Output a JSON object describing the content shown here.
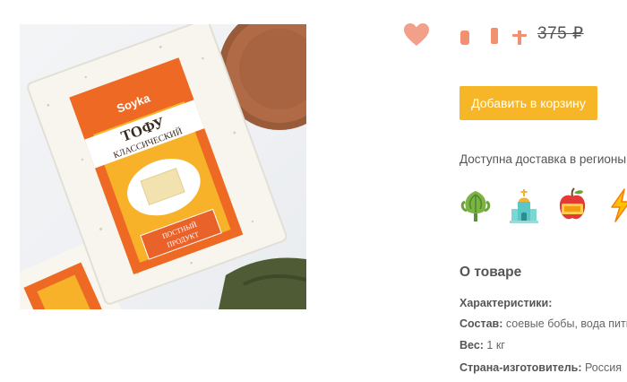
{
  "product": {
    "image_texts": {
      "brand": "Soyka",
      "name_line1": "ТОФУ",
      "name_line2": "КЛАССИЧЕСКИЙ",
      "badge_line1": "ПОСТНЫЙ",
      "badge_line2": "ПРОДУКТ"
    },
    "price_old": "375 ₽",
    "add_to_cart": "Добавить в корзину",
    "delivery_text": "Доступна доставка в регионы",
    "regions": [
      {
        "icon": "artichoke-icon"
      },
      {
        "icon": "church-icon"
      },
      {
        "icon": "apple-icon"
      },
      {
        "icon": "lightning-icon"
      }
    ],
    "about": {
      "title": "О товаре",
      "characteristics_label": "Характеристики:",
      "composition_label": "Состав:",
      "composition_value": " соевые бобы, вода питьевая",
      "weight_label": "Вес:",
      "weight_value": " 1 кг",
      "country_label": "Страна-изготовитель:",
      "country_value": " Россия"
    }
  },
  "colors": {
    "accent": "#f6b627",
    "heart": "#f2a08a",
    "package_orange": "#ee6a24",
    "package_yellow": "#f7b229"
  }
}
